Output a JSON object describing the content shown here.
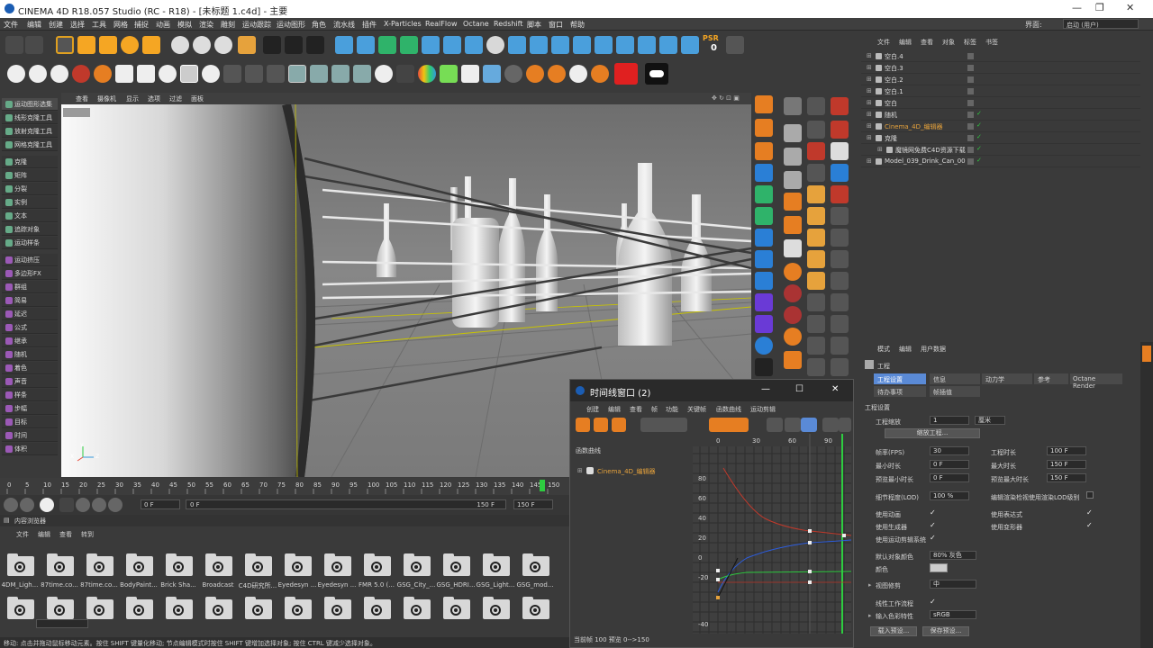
{
  "app": {
    "title": "CINEMA 4D R18.057 Studio (RC - R18) - [未标题 1.c4d] - 主要",
    "window_controls": [
      "—",
      "❐",
      "✕"
    ]
  },
  "menu": {
    "items": [
      "文件",
      "编辑",
      "创建",
      "选择",
      "工具",
      "网格",
      "捕捉",
      "动画",
      "模拟",
      "渲染",
      "雕刻",
      "运动跟踪",
      "运动图形",
      "角色",
      "流水线",
      "插件",
      "X-Particles",
      "RealFlow",
      "Octane",
      "Redshift",
      "脚本",
      "窗口",
      "帮助"
    ],
    "layout_label": "界面:",
    "layout_value": "启动 (用户)"
  },
  "toolbar": {
    "psr_label": "PSR",
    "psr_value": "0"
  },
  "left_panel": {
    "items": [
      "运动图形选集",
      "线形克隆工具",
      "放射克隆工具",
      "网格克隆工具",
      "克隆",
      "矩阵",
      "分裂",
      "实例",
      "文本",
      "追踪对象",
      "运动样条",
      "运动挤压",
      "多边形FX",
      "群组",
      "简易",
      "延迟",
      "公式",
      "继承",
      "随机",
      "着色",
      "声音",
      "样条",
      "步幅",
      "目标",
      "时间",
      "体积"
    ]
  },
  "viewport": {
    "menu": [
      "查看",
      "摄像机",
      "显示",
      "选项",
      "过滤",
      "面板"
    ],
    "axis_x": "X",
    "axis_y": "Y",
    "axis_z": "Z"
  },
  "timeline": {
    "ticks": [
      "0",
      "5",
      "10",
      "15",
      "20",
      "25",
      "30",
      "35",
      "40",
      "45",
      "50",
      "55",
      "60",
      "65",
      "70",
      "75",
      "80",
      "85",
      "90",
      "95",
      "100",
      "105",
      "110",
      "115",
      "120",
      "125",
      "130",
      "135",
      "140",
      "145",
      "150"
    ],
    "current_frame": "0 F",
    "start_frame": "0 F",
    "end_frame": "150 F",
    "end_frame2": "150 F"
  },
  "content_browser": {
    "title": "内容浏览器",
    "menu": [
      "文件",
      "编辑",
      "查看",
      "转到"
    ],
    "folders": [
      "4DM_Ligh...",
      "87time.co...",
      "87time.co...",
      "BodyPaint...",
      "Brick Sha...",
      "Broadcast",
      "C4D研究所...",
      "Eyedesyn ...",
      "Eyedesyn ...",
      "FMR 5.0 (...",
      "GSG_City_...",
      "GSG_HDRI...",
      "GSG_Light...",
      "GSG_mod..."
    ]
  },
  "status_bar": {
    "text": "移动: 点击并拖动鼠标移动元素。按住 SHIFT 键量化移动; 节点编辑模式时按住 SHIFT 键增加选择对象; 按住 CTRL 键减少选择对象。"
  },
  "timeline_window": {
    "title": "时间线窗口 (2)",
    "menu": [
      "创建",
      "编辑",
      "查看",
      "帧",
      "功能",
      "关键帧",
      "函数曲线",
      "运动剪辑"
    ],
    "section": "函数曲线",
    "track": "Cinema_4D_编辑器",
    "ruler": [
      "0",
      "30",
      "60",
      "90"
    ],
    "y_labels": [
      "80",
      "60",
      "40",
      "20",
      "0",
      "-20",
      "-40"
    ],
    "footer": "当前帧  100  预览  0-->150"
  },
  "object_manager": {
    "menu": [
      "文件",
      "编辑",
      "查看",
      "对象",
      "标签",
      "书签"
    ],
    "objects": [
      "空白.4",
      "空白.3",
      "空白.2",
      "空白.1",
      "空白",
      "随机",
      "Cinema_4D_编辑器",
      "克隆",
      "魔镜网免费C4D资源下载",
      "Model_039_Drink_Can_00"
    ]
  },
  "attributes": {
    "menu": [
      "模式",
      "编辑",
      "用户数据"
    ],
    "header": "工程",
    "tabs": [
      "工程设置",
      "信息",
      "动力学",
      "参考",
      "Octane Render",
      "待办事项",
      "帧插值"
    ],
    "section": "工程设置",
    "scale_label": "工程缩放",
    "scale_value": "1",
    "scale_unit": "厘米",
    "scale_button": "缩放工程...",
    "fps_label": "帧率(FPS)",
    "fps_value": "30",
    "min_time_label": "最小时长",
    "min_time_value": "0 F",
    "preview_min_label": "预览最小时长",
    "preview_min_value": "0 F",
    "duration_label": "工程时长",
    "duration_value": "100 F",
    "max_time_label": "最大时长",
    "max_time_value": "150 F",
    "preview_max_label": "预览最大时长",
    "preview_max_value": "150 F",
    "lod_label": "细节程度(LOD)",
    "lod_value": "100 %",
    "lod_render_label": "编辑渲染检视使用渲染LOD级别",
    "use_anim_label": "使用动画",
    "use_expr_label": "使用表达式",
    "use_gen_label": "使用生成器",
    "use_deform_label": "使用变形器",
    "use_mograph_label": "使用运动剪辑系统",
    "default_color_label": "默认对象颜色",
    "default_color_value": "80% 灰色",
    "color_label": "颜色",
    "view_clip_label": "视图修剪",
    "view_clip_value": "中",
    "linear_label": "线性工作流程",
    "input_color_label": "输入色彩特性",
    "input_color_value": "sRGB",
    "load_preset": "载入预设...",
    "save_preset": "保存预设..."
  }
}
